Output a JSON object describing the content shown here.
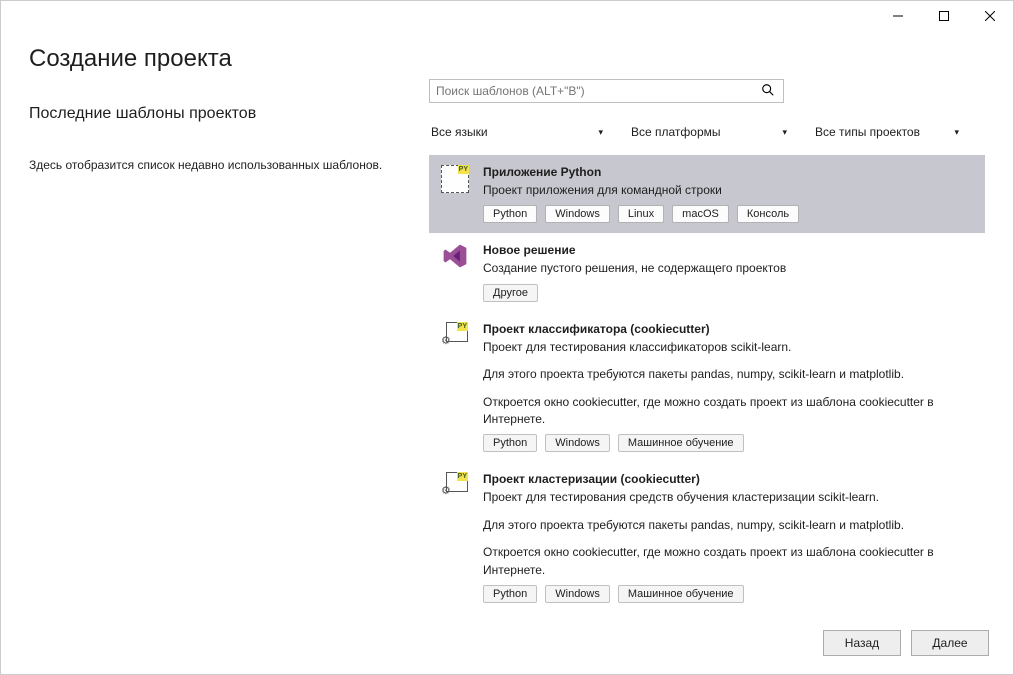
{
  "window": {
    "title": "Создание проекта"
  },
  "recent": {
    "heading": "Последние шаблоны проектов",
    "text": "Здесь отобразится список недавно использованных шаблонов."
  },
  "search": {
    "placeholder": "Поиск шаблонов (ALT+\"В\")"
  },
  "filters": {
    "language": "Все языки",
    "platform": "Все платформы",
    "project_type": "Все типы проектов"
  },
  "templates": [
    {
      "icon": "python-app",
      "title": "Приложение Python",
      "lines": [
        "Проект приложения для командной строки"
      ],
      "tags": [
        "Python",
        "Windows",
        "Linux",
        "macOS",
        "Консоль"
      ],
      "selected": true
    },
    {
      "icon": "vs-solution",
      "title": "Новое решение",
      "lines": [
        "Создание пустого решения, не содержащего проектов"
      ],
      "tags": [
        "Другое"
      ],
      "selected": false
    },
    {
      "icon": "cookiecutter",
      "title": "Проект классификатора (cookiecutter)",
      "lines": [
        "Проект для тестирования классификаторов scikit-learn.",
        "Для этого проекта требуются пакеты pandas, numpy, scikit-learn и matplotlib.",
        "Откроется окно cookiecutter, где можно создать проект из шаблона cookiecutter в Интернете."
      ],
      "tags": [
        "Python",
        "Windows",
        "Машинное обучение"
      ],
      "selected": false
    },
    {
      "icon": "cookiecutter",
      "title": "Проект кластеризации (cookiecutter)",
      "lines": [
        "Проект для тестирования средств обучения кластеризации scikit-learn.",
        "Для этого проекта требуются пакеты pandas, numpy, scikit-learn и matplotlib.",
        "Откроется окно cookiecutter, где можно создать проект из шаблона cookiecutter в Интернете."
      ],
      "tags": [
        "Python",
        "Windows",
        "Машинное обучение"
      ],
      "selected": false
    }
  ],
  "footer": {
    "back": "Назад",
    "next": "Далее"
  }
}
